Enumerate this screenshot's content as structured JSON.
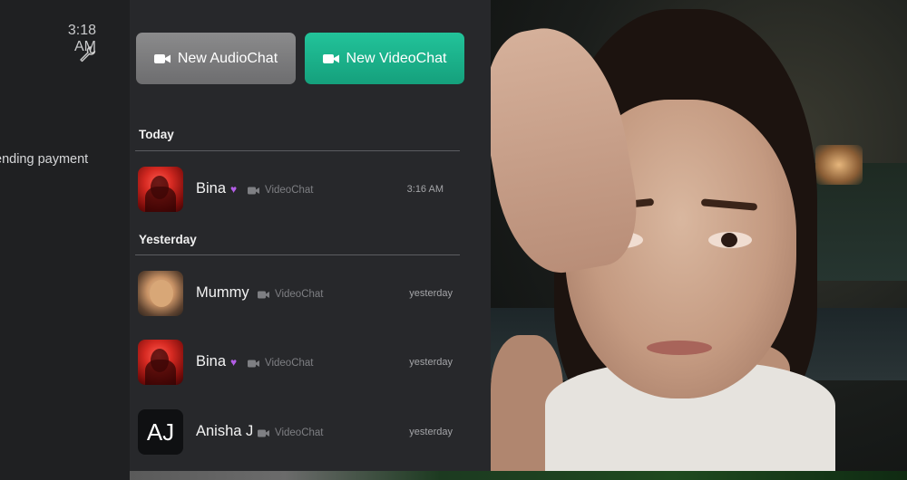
{
  "status": {
    "time": "3:18 AM",
    "tool_icon": "wrench-icon"
  },
  "notice": {
    "text": "ending payment"
  },
  "actions": {
    "audio_label": "New AudioChat",
    "video_label": "New VideoChat",
    "audio_icon": "video-camera-icon",
    "video_icon": "video-camera-icon",
    "audio_color": "#7d7d7e",
    "video_color": "#1bb18b"
  },
  "sections": {
    "today": "Today",
    "yesterday": "Yesterday"
  },
  "calls": [
    {
      "name": "Bina",
      "badge": "purple-heart-icon",
      "type": "VideoChat",
      "time": "3:16 AM",
      "avatar": "photo-red"
    },
    {
      "name": "Mummy",
      "badge": "",
      "type": "VideoChat",
      "time": "yesterday",
      "avatar": "photo"
    },
    {
      "name": "Bina",
      "badge": "purple-heart-icon",
      "type": "VideoChat",
      "time": "yesterday",
      "avatar": "photo-red"
    },
    {
      "name": "Anisha J",
      "badge": "",
      "type": "VideoChat",
      "time": "yesterday",
      "avatar": "initials",
      "initials": "AJ"
    }
  ]
}
